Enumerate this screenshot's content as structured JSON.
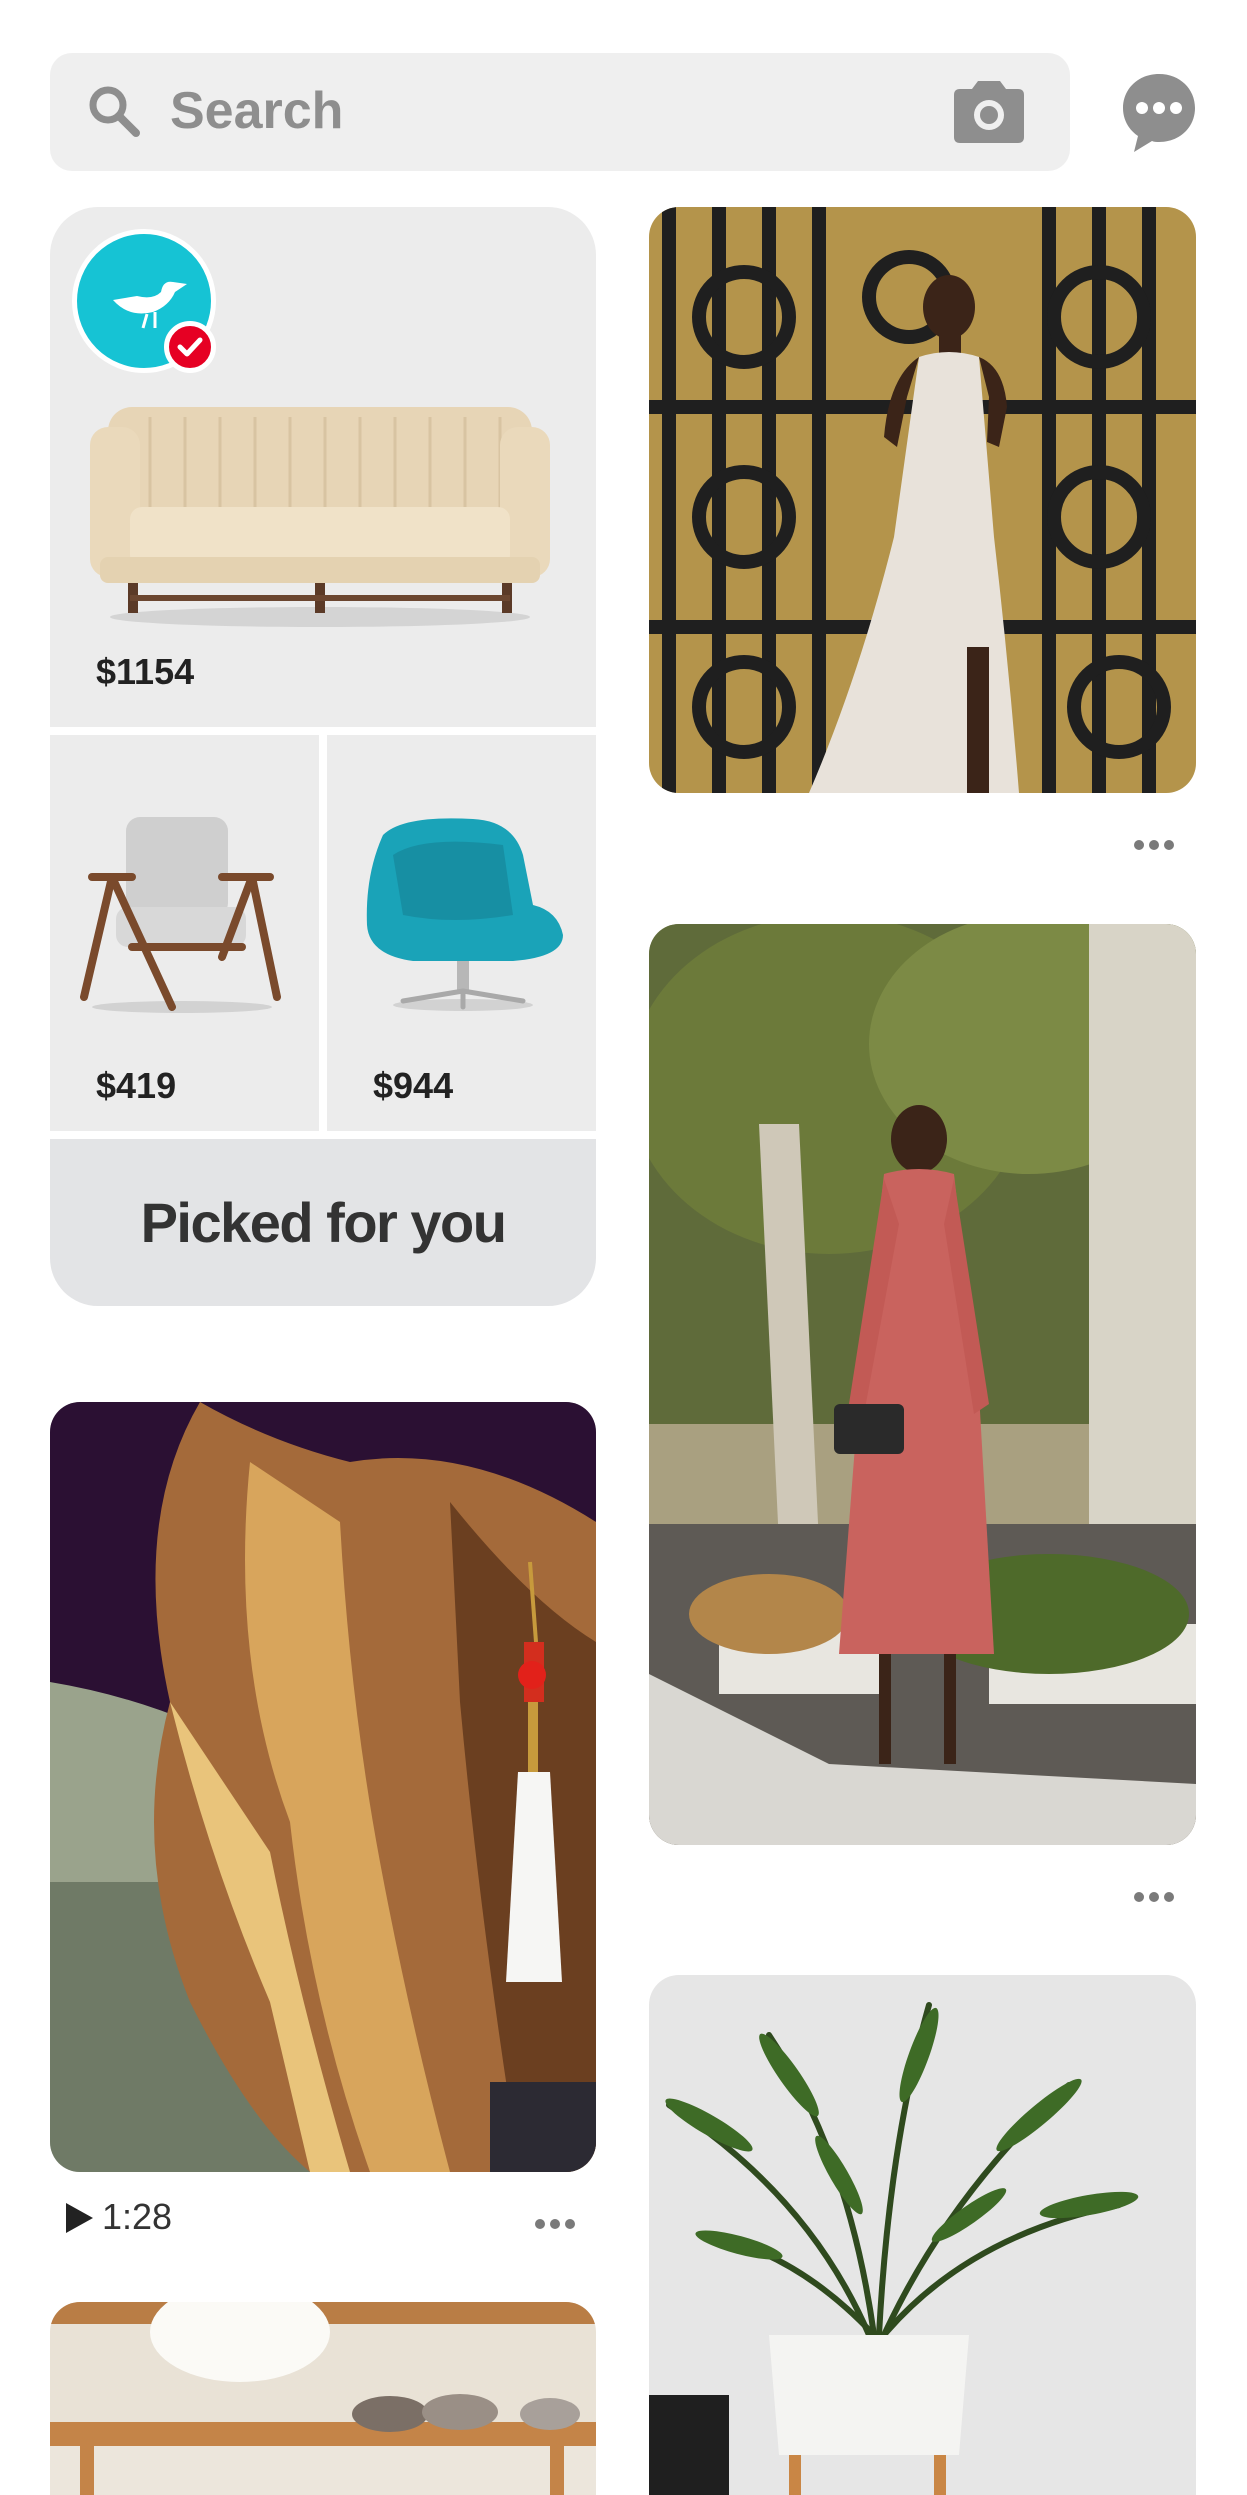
{
  "search": {
    "placeholder": "Search"
  },
  "shopping_card": {
    "items": [
      {
        "product": "sofa",
        "price": "$1154"
      },
      {
        "product": "armchair",
        "price": "$419"
      },
      {
        "product": "swivel-chair",
        "price": "$944"
      }
    ],
    "footer_label": "Picked for you"
  },
  "pins": [
    {
      "subject": "woman in lace dress at iron gate"
    },
    {
      "subject": "woman in pink dress with handbag"
    },
    {
      "subject": "hair and tassel earring",
      "video_duration": "1:28"
    },
    {
      "subject": "potted palm plant"
    },
    {
      "subject": "wooden shelves"
    }
  ],
  "colors": {
    "brand_avatar": "#16c3d4",
    "verified_badge": "#e60023",
    "search_bg": "#efefef",
    "footer_bg": "#e3e4e6"
  }
}
